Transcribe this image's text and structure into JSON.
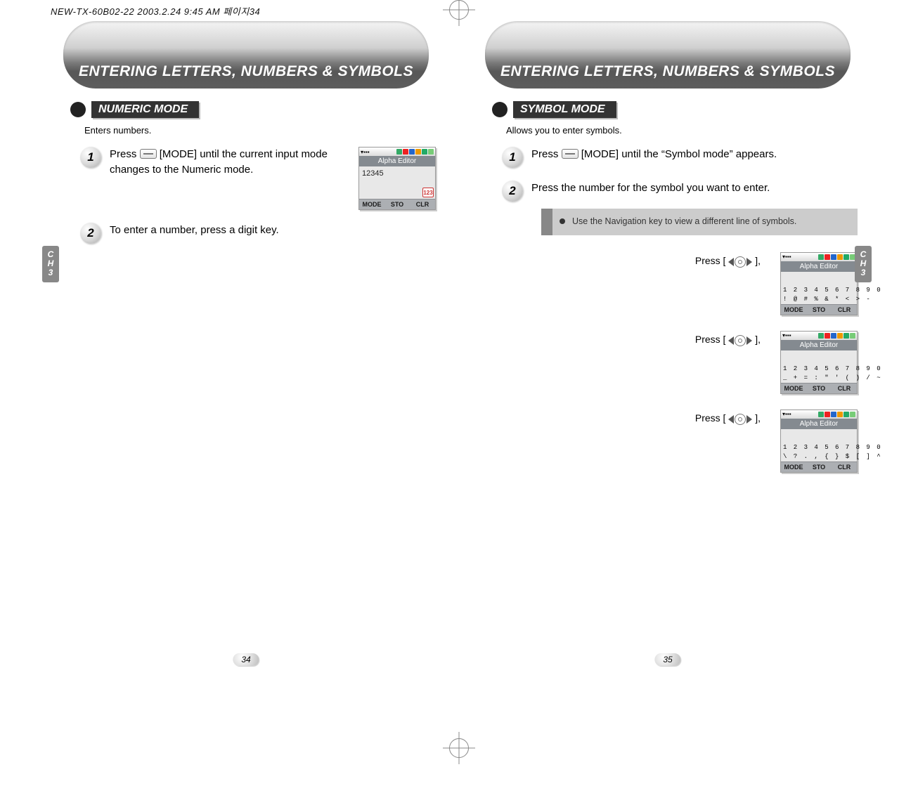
{
  "print_header": "NEW-TX-60B02-22  2003.2.24 9:45 AM  페이지34",
  "banner_title": "ENTERING LETTERS, NUMBERS & SYMBOLS",
  "ch_tab": {
    "line1": "C",
    "line2": "H",
    "line3": "3"
  },
  "left": {
    "section": "NUMERIC MODE",
    "subtitle": "Enters numbers.",
    "step1": {
      "num": "1",
      "text_a": "Press ",
      "text_b": " [MODE] until the current input mode changes to the Numeric mode."
    },
    "step2": {
      "num": "2",
      "text": "To enter a number, press a digit key."
    },
    "phone": {
      "title": "Alpha Editor",
      "body": "12345",
      "mode_icon": "123",
      "soft": [
        "MODE",
        "STO",
        "CLR"
      ]
    },
    "pagenum": "34"
  },
  "right": {
    "section": "SYMBOL MODE",
    "subtitle": "Allows you to enter symbols.",
    "step1": {
      "num": "1",
      "text_a": "Press  ",
      "text_b": "  [MODE] until the “Symbol mode” appears."
    },
    "step2": {
      "num": "2",
      "text": "Press the number for the symbol you want to enter."
    },
    "tip": "Use the Navigation key to view a different line of symbols.",
    "press_label": "Press [",
    "press_suffix": "],",
    "phones": [
      {
        "title": "Alpha Editor",
        "row1": "1 2 3 4 5 6 7 8 9 0",
        "row2": "! @ # % & * < > -",
        "soft": [
          "MODE",
          "STO",
          "CLR"
        ]
      },
      {
        "title": "Alpha Editor",
        "row1": "1 2 3 4 5 6 7 8 9 0",
        "row2": "_ + = : \" ' ( ) / ~",
        "soft": [
          "MODE",
          "STO",
          "CLR"
        ]
      },
      {
        "title": "Alpha Editor",
        "row1": "1 2 3 4 5 6 7 8 9 0",
        "row2": "\\ ? . , { } $ [ ] ^",
        "soft": [
          "MODE",
          "STO",
          "CLR"
        ]
      }
    ],
    "pagenum": "35"
  },
  "status_icons": {
    "colors": [
      "#3a6",
      "#e22",
      "#26c",
      "#e90",
      "#2a6",
      "#888"
    ]
  }
}
